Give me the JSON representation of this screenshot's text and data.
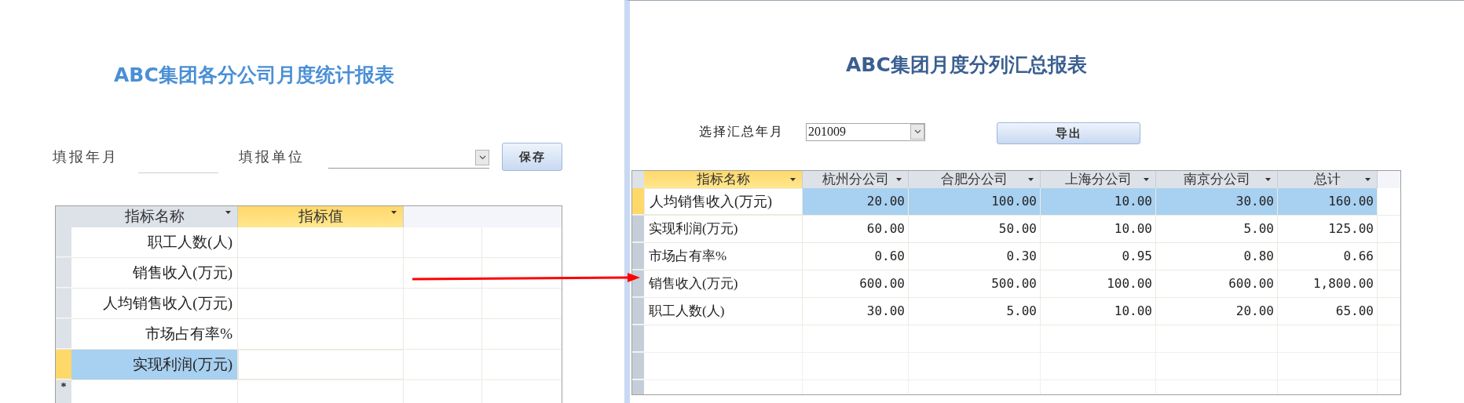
{
  "left_form": {
    "title": "ABC集团各分公司月度统计报表",
    "fields": [
      {
        "kind": "text",
        "label": "填报年月"
      },
      {
        "kind": "combo",
        "label": "填报单位"
      }
    ],
    "save_button": "保存",
    "grid": {
      "columns": [
        {
          "label": "指标名称",
          "selected": false
        },
        {
          "label": "指标值",
          "selected": true
        }
      ],
      "rows": [
        {
          "name": "职工人数(人)",
          "selected": false
        },
        {
          "name": "销售收入(万元)",
          "selected": false
        },
        {
          "name": "人均销售收入(万元)",
          "selected": false
        },
        {
          "name": "市场占有率%",
          "selected": false
        },
        {
          "name": "实现利润(万元)",
          "selected": true
        }
      ],
      "new_row_marker": "*"
    }
  },
  "right_form": {
    "title": "ABC集团月度分列汇总报表",
    "month_label": "选择汇总年月",
    "month_value": "201009",
    "export_button": "导出",
    "grid": {
      "columns": [
        {
          "label": "指标名称",
          "selected": true
        },
        {
          "label": "杭州分公司",
          "selected": false
        },
        {
          "label": "合肥分公司",
          "selected": false
        },
        {
          "label": "上海分公司",
          "selected": false
        },
        {
          "label": "南京分公司",
          "selected": false
        },
        {
          "label": "总计",
          "selected": false
        }
      ],
      "rows": [
        {
          "name": "人均销售收入(万元)",
          "selected": true,
          "values": [
            "20.00",
            "100.00",
            "10.00",
            "30.00",
            "160.00"
          ]
        },
        {
          "name": "实现利润(万元)",
          "selected": false,
          "values": [
            "60.00",
            "50.00",
            "10.00",
            "5.00",
            "125.00"
          ]
        },
        {
          "name": "市场占有率%",
          "selected": false,
          "values": [
            "0.60",
            "0.30",
            "0.95",
            "0.80",
            "0.66"
          ]
        },
        {
          "name": "销售收入(万元)",
          "selected": false,
          "values": [
            "600.00",
            "500.00",
            "100.00",
            "600.00",
            "1,800.00"
          ]
        },
        {
          "name": "职工人数(人)",
          "selected": false,
          "values": [
            "30.00",
            "5.00",
            "10.00",
            "20.00",
            "65.00"
          ]
        }
      ]
    }
  }
}
